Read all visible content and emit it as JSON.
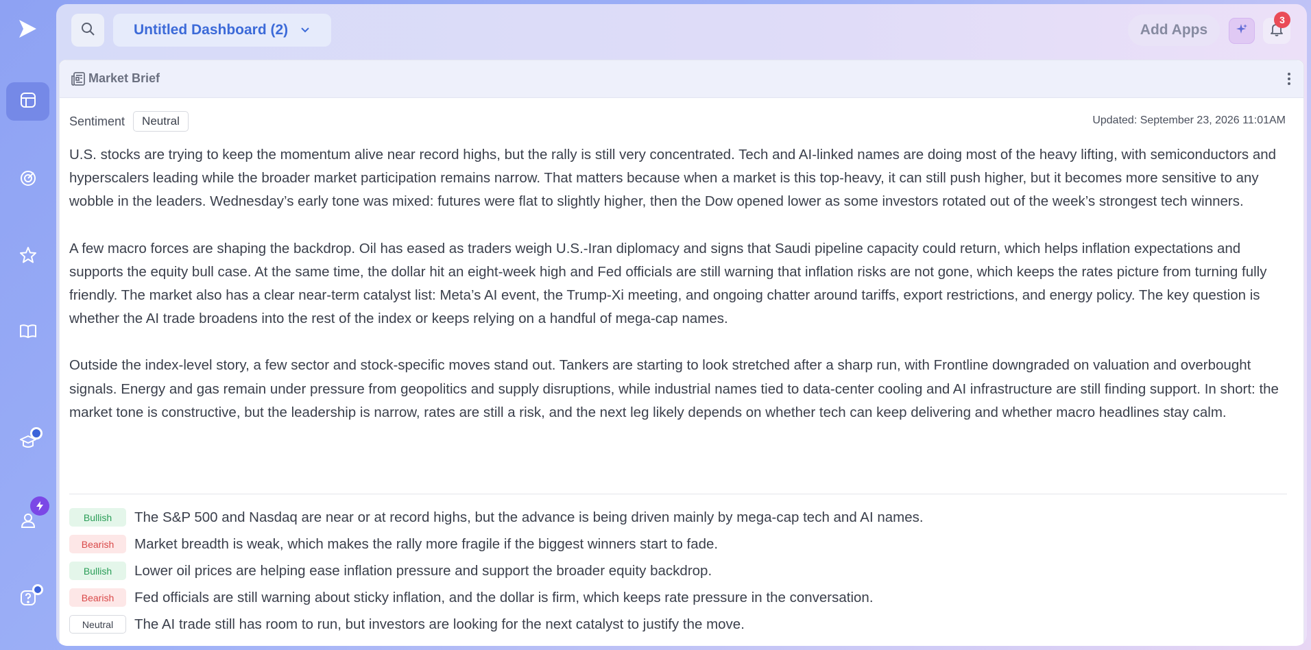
{
  "topbar": {
    "dashboard_title": "Untitled Dashboard (2)",
    "add_apps_label": "Add Apps",
    "notification_count": "3"
  },
  "sidebar": {
    "items": [
      {
        "name": "dashboards",
        "icon": "layout-icon",
        "active": true
      },
      {
        "name": "activity",
        "icon": "radar-icon",
        "active": false
      },
      {
        "name": "favorites",
        "icon": "star-icon",
        "active": false
      },
      {
        "name": "library",
        "icon": "book-icon",
        "active": false
      },
      {
        "name": "learning",
        "icon": "graduation-cap-icon",
        "active": false
      },
      {
        "name": "profile",
        "icon": "user-icon",
        "active": false
      },
      {
        "name": "help",
        "icon": "help-icon",
        "active": false
      }
    ]
  },
  "widget": {
    "title": "Market Brief",
    "sentiment_label": "Sentiment",
    "sentiment_value": "Neutral",
    "updated": "Updated: September 23, 2026 11:01AM",
    "paragraphs": [
      "U.S. stocks are trying to keep the momentum alive near record highs, but the rally is still very concentrated. Tech and AI-linked names are doing most of the heavy lifting, with semiconductors and hyperscalers leading while the broader market participation remains narrow. That matters because when a market is this top-heavy, it can still push higher, but it becomes more sensitive to any wobble in the leaders. Wednesday’s early tone was mixed: futures were flat to slightly higher, then the Dow opened lower as some investors rotated out of the week’s strongest tech winners.",
      "A few macro forces are shaping the backdrop. Oil has eased as traders weigh U.S.-Iran diplomacy and signs that Saudi pipeline capacity could return, which helps inflation expectations and supports the equity bull case. At the same time, the dollar hit an eight-week high and Fed officials are still warning that inflation risks are not gone, which keeps the rates picture from turning fully friendly. The market also has a clear near-term catalyst list: Meta’s AI event, the Trump-Xi meeting, and ongoing chatter around tariffs, export restrictions, and energy policy. The key question is whether the AI trade broadens into the rest of the index or keeps relying on a handful of mega-cap names.",
      "Outside the index-level story, a few sector and stock-specific moves stand out. Tankers are starting to look stretched after a sharp run, with Frontline downgraded on valuation and overbought signals. Energy and gas remain under pressure from geopolitics and supply disruptions, while industrial names tied to data-center cooling and AI infrastructure are still finding support. In short: the market tone is constructive, but the leadership is narrow, rates are still a risk, and the next leg likely depends on whether tech can keep delivering and whether macro headlines stay calm."
    ],
    "points": [
      {
        "tag": "Bullish",
        "kind": "bullish",
        "text": "The S&P 500 and Nasdaq are near or at record highs, but the advance is being driven mainly by mega-cap tech and AI names."
      },
      {
        "tag": "Bearish",
        "kind": "bearish",
        "text": "Market breadth is weak, which makes the rally more fragile if the biggest winners start to fade."
      },
      {
        "tag": "Bullish",
        "kind": "bullish",
        "text": "Lower oil prices are helping ease inflation pressure and support the broader equity backdrop."
      },
      {
        "tag": "Bearish",
        "kind": "bearish",
        "text": "Fed officials are still warning about sticky inflation, and the dollar is firm, which keeps rate pressure in the conversation."
      },
      {
        "tag": "Neutral",
        "kind": "neutral",
        "text": "The AI trade still has room to run, but investors are looking for the next catalyst to justify the move."
      }
    ]
  },
  "colors": {
    "accent": "#3c6ad8",
    "bullish": "#2a9d57",
    "bearish": "#d94848",
    "badge": "#ea4b57"
  }
}
